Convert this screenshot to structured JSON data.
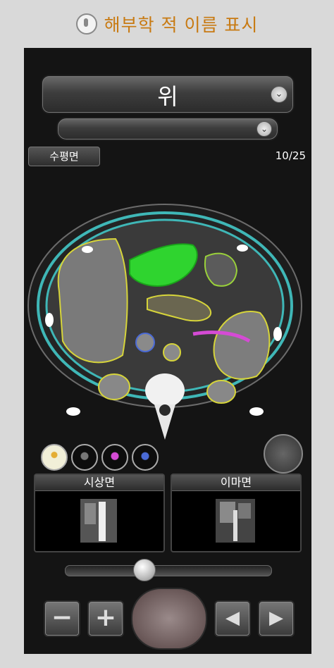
{
  "header": {
    "title": "해부학 적 이름 표시",
    "icon": "touch-hand-icon"
  },
  "structure_select": {
    "selected": "위",
    "icon": "chevron-down-icon"
  },
  "sub_select": {
    "selected": "",
    "icon": "chevron-down-icon"
  },
  "view": {
    "plane": "수평면",
    "slice_counter": "10/25"
  },
  "layers": {
    "icons": [
      "bone-layer-icon",
      "vessel-layer-icon",
      "artery-layer-icon",
      "vein-layer-icon"
    ],
    "active_index": 0
  },
  "thumbnails": {
    "sagittal_label": "시상면",
    "coronal_label": "이마면"
  },
  "slider": {
    "position": 0.38
  },
  "controls": {
    "minus": "−",
    "plus": "+",
    "touch_icon": "hand-pointer-icon",
    "prev_icon": "triangle-left-icon",
    "next_icon": "triangle-right-icon"
  },
  "colors": {
    "header_text": "#c87a12",
    "highlight_organ": "#2fd42f",
    "outline": "#3fb7b7"
  }
}
